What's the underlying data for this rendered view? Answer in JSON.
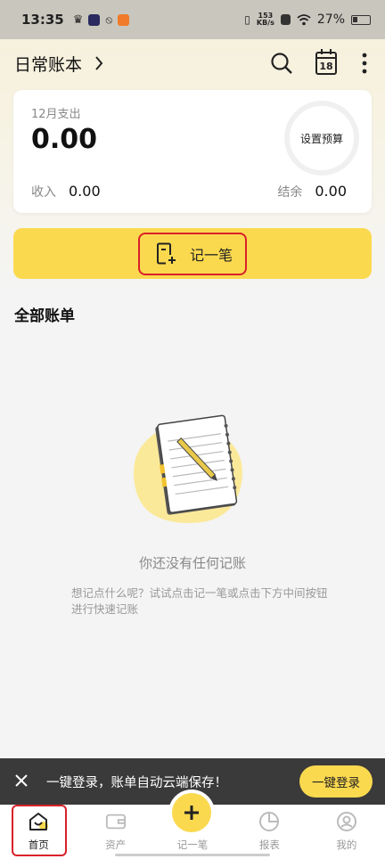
{
  "status_bar": {
    "time": "13:35",
    "net_speed_value": "153",
    "net_speed_unit": "KB/s",
    "battery_percent": "27%"
  },
  "header": {
    "book_title": "日常账本",
    "calendar_day": "18"
  },
  "summary": {
    "month_expense_label": "12月支出",
    "expense_value": "0.00",
    "budget_label": "设置预算",
    "income_label": "收入",
    "income_value": "0.00",
    "balance_label": "结余",
    "balance_value": "0.00"
  },
  "add_record": {
    "label": "记一笔"
  },
  "bills": {
    "section_title": "全部账单",
    "empty_title": "你还没有任何记账",
    "empty_description": "想记点什么呢？试试点击记一笔或点击下方中间按钮进行快速记账"
  },
  "login_banner": {
    "text": "一键登录，账单自动云端保存！",
    "button_label": "一键登录"
  },
  "bottom_nav": {
    "home": "首页",
    "assets": "资产",
    "record": "记一笔",
    "reports": "报表",
    "mine": "我的"
  },
  "colors": {
    "accent_yellow": "#fbd94f",
    "highlight_red": "#d8212a",
    "banner_dark": "#3a3a3a"
  }
}
